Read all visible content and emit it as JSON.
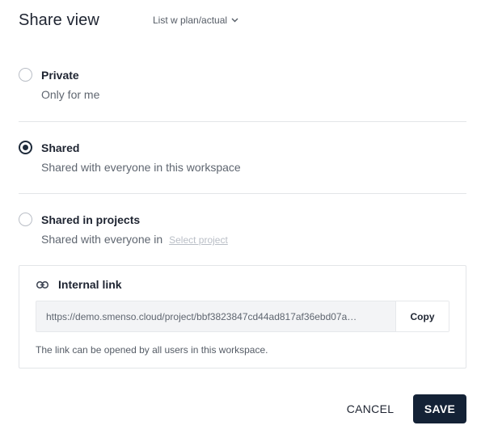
{
  "header": {
    "title": "Share view",
    "view_selector": "List w plan/actual"
  },
  "options": [
    {
      "title": "Private",
      "description": "Only for me",
      "selected": false
    },
    {
      "title": "Shared",
      "description": "Shared with everyone in this workspace",
      "selected": true
    },
    {
      "title": "Shared in projects",
      "description": "Shared with everyone in",
      "link_text": "Select project",
      "selected": false
    }
  ],
  "internal_link": {
    "title": "Internal link",
    "url": "https://demo.smenso.cloud/project/bbf3823847cd44ad817af36ebd07a…",
    "copy_label": "Copy",
    "note": "The link can be opened by all users in this workspace."
  },
  "footer": {
    "cancel_label": "CANCEL",
    "save_label": "SAVE"
  },
  "colors": {
    "primary": "#142236",
    "muted_text": "#5f6670",
    "divider": "#e3e5e8"
  }
}
